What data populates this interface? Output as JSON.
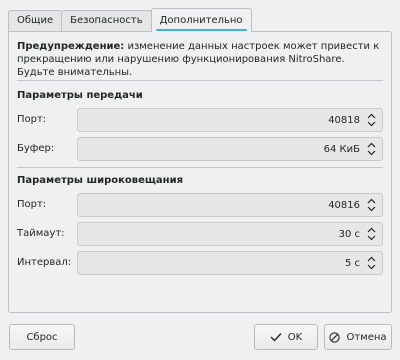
{
  "tabs": [
    {
      "label": "Общие"
    },
    {
      "label": "Безопасность"
    },
    {
      "label": "Дополнительно"
    }
  ],
  "warning": {
    "bold": "Предупреждение:",
    "text": " изменение данных настроек может привести к прекращению или нарушению функционирования NitroShare. Будьте внимательны."
  },
  "transfer": {
    "title": "Параметры передачи",
    "port_label": "Порт:",
    "port_value": "40818",
    "buffer_label": "Буфер:",
    "buffer_value": "64 КиБ"
  },
  "broadcast": {
    "title": "Параметры широковещания",
    "port_label": "Порт:",
    "port_value": "40816",
    "timeout_label": "Таймаут:",
    "timeout_value": "30 с",
    "interval_label": "Интервал:",
    "interval_value": "5 с"
  },
  "buttons": {
    "reset": "Сброс",
    "ok": "OK",
    "cancel": "Отмена"
  },
  "colors": {
    "accent": "#3daee9",
    "background": "#eff0f1"
  }
}
